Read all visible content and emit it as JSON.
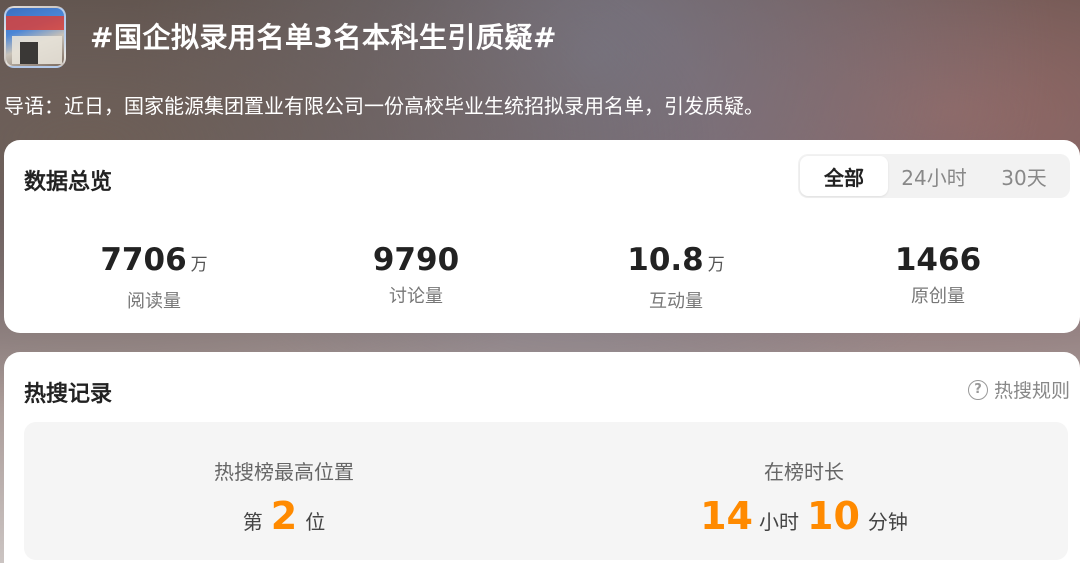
{
  "topic": {
    "thumbnail_icon": "topic-cover-photo",
    "title": "#国企拟录用名单3名本科生引质疑#",
    "intro": "导语：近日，国家能源集团置业有限公司一份高校毕业生统招拟录用名单，引发质疑。"
  },
  "overview": {
    "title": "数据总览",
    "tabs": [
      {
        "label": "全部",
        "active": true
      },
      {
        "label": "24小时",
        "active": false
      },
      {
        "label": "30天",
        "active": false
      }
    ],
    "stats": [
      {
        "value": "7706",
        "unit": "万",
        "label": "阅读量"
      },
      {
        "value": "9790",
        "unit": "",
        "label": "讨论量"
      },
      {
        "value": "10.8",
        "unit": "万",
        "label": "互动量"
      },
      {
        "value": "1466",
        "unit": "",
        "label": "原创量"
      }
    ]
  },
  "hot_search": {
    "title": "热搜记录",
    "rules_icon": "question-circle-icon",
    "rules_label": "热搜规则",
    "highest_rank": {
      "label": "热搜榜最高位置",
      "prefix": "第",
      "value": "2",
      "suffix": "位"
    },
    "duration": {
      "label": "在榜时长",
      "hours": "14",
      "hours_unit": "小时",
      "minutes": "10",
      "minutes_unit": "分钟"
    }
  },
  "colors": {
    "accent_orange": "#ff8a00",
    "card_bg": "#ffffff",
    "panel_bg": "#f5f5f5"
  }
}
